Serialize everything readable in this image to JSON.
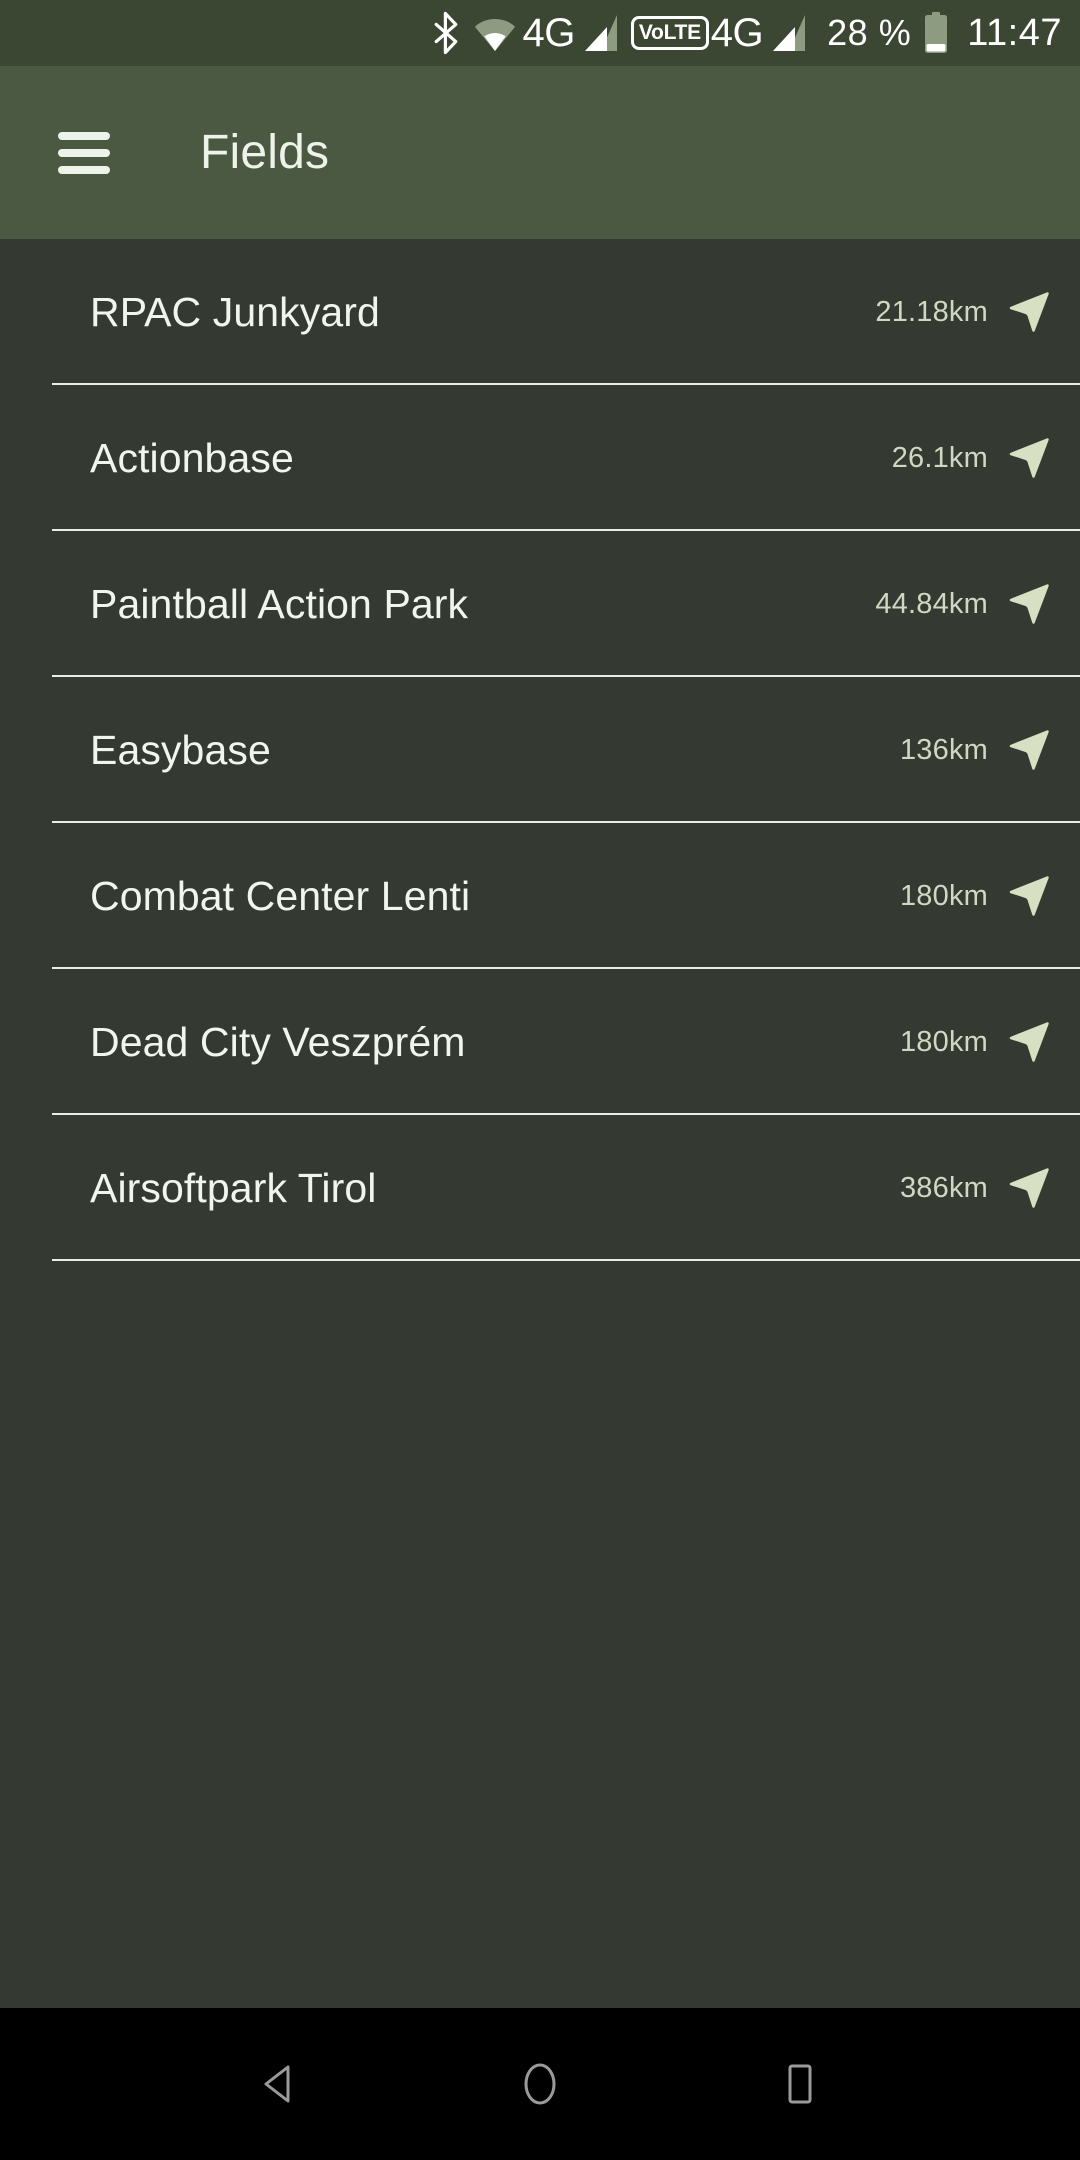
{
  "status_bar": {
    "bluetooth_icon": "bluetooth-icon",
    "wifi_icon": "wifi-icon",
    "network_type_1": "4G",
    "signal_icon_1": "signal-bars-icon",
    "volte_label": "VoLTE",
    "network_type_2": "4G",
    "signal_icon_2": "signal-bars-icon",
    "battery_percent": "28 %",
    "battery_icon": "battery-icon",
    "clock": "11:47"
  },
  "app_bar": {
    "menu_icon": "hamburger-menu-icon",
    "title": "Fields"
  },
  "list": {
    "items": [
      {
        "name": "RPAC Junkyard",
        "distance": "21.18km",
        "action_icon": "navigation-arrow-icon"
      },
      {
        "name": "Actionbase",
        "distance": "26.1km",
        "action_icon": "navigation-arrow-icon"
      },
      {
        "name": "Paintball Action Park",
        "distance": "44.84km",
        "action_icon": "navigation-arrow-icon"
      },
      {
        "name": "Easybase",
        "distance": "136km",
        "action_icon": "navigation-arrow-icon"
      },
      {
        "name": "Combat Center Lenti",
        "distance": "180km",
        "action_icon": "navigation-arrow-icon"
      },
      {
        "name": "Dead City Veszprém",
        "distance": "180km",
        "action_icon": "navigation-arrow-icon"
      },
      {
        "name": "Airsoftpark Tirol",
        "distance": "386km",
        "action_icon": "navigation-arrow-icon"
      }
    ]
  },
  "nav_bar": {
    "back_icon": "back-triangle-icon",
    "home_icon": "home-circle-icon",
    "recents_icon": "recents-square-icon"
  },
  "colors": {
    "status_bar_bg": "#3c4733",
    "app_bar_bg": "#4b5842",
    "content_bg": "#343a31",
    "nav_bar_bg": "#000000",
    "primary_text": "#f2f5ee",
    "secondary_text": "#cfd8c2",
    "accent_icon": "#d7e0c2",
    "divider": "#e9eee4"
  }
}
